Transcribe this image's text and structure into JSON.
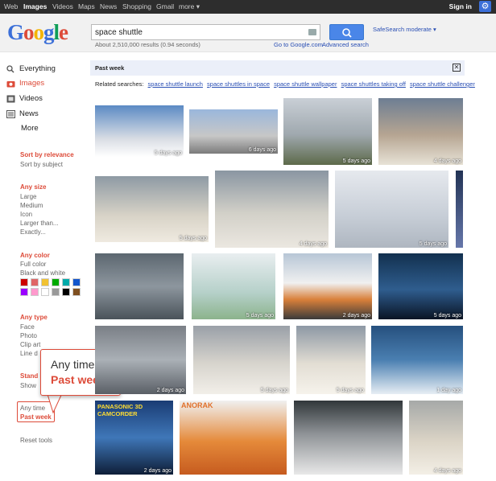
{
  "topnav": {
    "items": [
      "Web",
      "Images",
      "Videos",
      "Maps",
      "News",
      "Shopping",
      "Gmail",
      "more ▾"
    ],
    "signin": "Sign in"
  },
  "logo_letters": [
    "G",
    "o",
    "o",
    "g",
    "l",
    "e"
  ],
  "logo_colors": [
    "#3b6fd8",
    "#dd4b39",
    "#f4b400",
    "#3b6fd8",
    "#0f9d58",
    "#dd4b39"
  ],
  "search": {
    "query": "space shuttle",
    "results_count": "About 2,510,000 results (0.94 seconds)",
    "goto_link": "Go to Google.com",
    "advanced_link": "Advanced search",
    "safesearch": "SafeSearch moderate ▾"
  },
  "sidebar": {
    "types": [
      "Everything",
      "Images",
      "Videos",
      "News",
      "More"
    ],
    "sort_relevance": "Sort by relevance",
    "sort_subject": "Sort by subject",
    "any_size": "Any size",
    "sizes": [
      "Large",
      "Medium",
      "Icon",
      "Larger than...",
      "Exactly..."
    ],
    "any_color": "Any color",
    "color_options": [
      "Full color",
      "Black and white"
    ],
    "any_type": "Any type",
    "types_list": [
      "Face",
      "Photo",
      "Clip art",
      "Line d"
    ],
    "standard": "Stand",
    "show": "Show",
    "time_any": "Any time",
    "time_past": "Past week",
    "reset": "Reset tools"
  },
  "swatches": [
    "#cc0000",
    "#e06666",
    "#f1c232",
    "#00aa00",
    "#00aaaa",
    "#1155cc",
    "#9900ff",
    "#ff99cc",
    "#ffffff",
    "#999999",
    "#000000",
    "#7f4f1f"
  ],
  "callout": {
    "any": "Any time",
    "past": "Past week"
  },
  "filter_bar": {
    "label": "Past week",
    "close": "✕"
  },
  "related": {
    "label": "Related searches:",
    "links": [
      "space shuttle launch",
      "space shuttles in space",
      "space shuttle wallpaper",
      "space shuttles taking off",
      "space shuttle challenger"
    ]
  },
  "thumbnails": [
    {
      "age": "5 days ago",
      "bg": "linear-gradient(#5b8ac4,#d9dde4 65%,#ffffff)"
    },
    {
      "age": "6 days ago",
      "bg": "linear-gradient(#9ab7dc,#c7c7c7 60%,#7b7b7b)"
    },
    {
      "age": "5 days ago",
      "bg": "linear-gradient(#c9cfd6,#9fa8ae 55%,#5d6a4a)"
    },
    {
      "age": "4 days ago",
      "bg": "linear-gradient(#6d7e93,#b6a592 55%,#e7e2d6)"
    },
    {
      "age": "5 days ago",
      "bg": "linear-gradient(#8e9aa4,#d8d3c7 60%,#efeae0)"
    },
    {
      "age": "4 days ago",
      "bg": "linear-gradient(#8a96a2,#d2d0c8 55%,#ebe7e0)"
    },
    {
      "age": "5 days ago",
      "bg": "linear-gradient(#e6e9ee,#c6cdd6 60%,#aeb6c0)"
    },
    {
      "age": "",
      "bg": "linear-gradient(#223355,#6677aa)"
    },
    {
      "age": "",
      "bg": "linear-gradient(#5c6770,#8d969e 50%,#4a535a)"
    },
    {
      "age": "5 days ago",
      "bg": "linear-gradient(#e9eef0,#b5d0c9 60%,#8cb38c)"
    },
    {
      "age": "2 days ago",
      "bg": "linear-gradient(#b7c6d6,#f0f0f0 45%,#d9803a 70%,#3a3a3a)"
    },
    {
      "age": "5 days ago",
      "bg": "linear-gradient(#12304f,#2f5d8e 55%,#0a1424)"
    },
    {
      "age": "2 days ago",
      "bg": "linear-gradient(#7a7f86,#aab0b6 50%,#5a5f66)"
    },
    {
      "age": "5 days ago",
      "bg": "linear-gradient(#9aa0a8,#d7d4cd 55%,#f2efe9)"
    },
    {
      "age": "5 days ago",
      "bg": "linear-gradient(#8d98a4,#e2ddd3 55%,#f6f3ec)"
    },
    {
      "age": "1 day ago",
      "bg": "linear-gradient(#26507e,#4a7fb1 50%,#e7eef4)"
    },
    {
      "age": "2 days ago",
      "bg": "linear-gradient(#1a3c74,#3f77b8 50%,#0e1e38)"
    },
    {
      "age": "",
      "bg": "linear-gradient(#f0f0f0,#e58a3a 55%,#c65b1f)"
    },
    {
      "age": "",
      "bg": "linear-gradient(#31373a,#8f9397 45%,#e8e8e8)"
    },
    {
      "age": "4 days ago",
      "bg": "linear-gradient(#a6a9a8,#dbd4c6 55%,#f3efe6)"
    }
  ],
  "thumb_labels": {
    "brand": "PANASONIC 3D CAMCORDER",
    "anorak": "ANORAK"
  }
}
